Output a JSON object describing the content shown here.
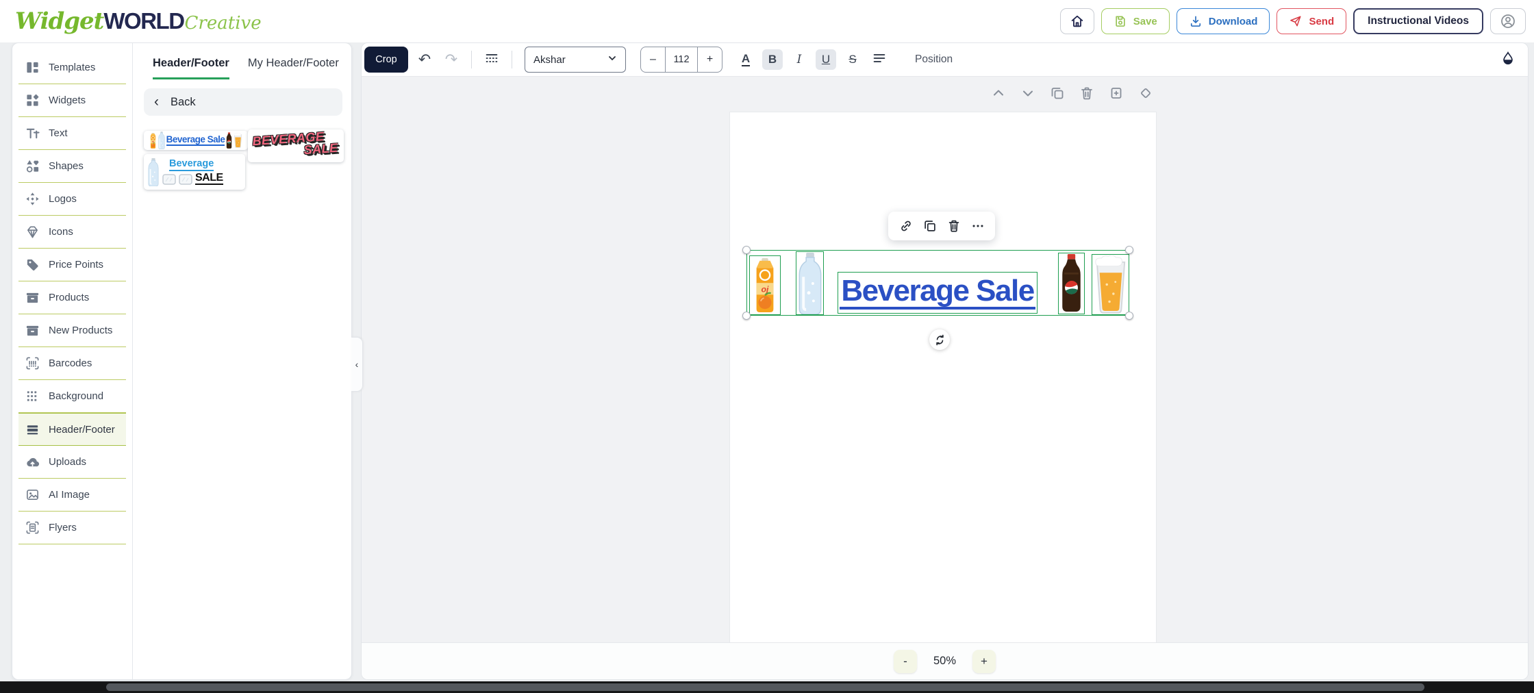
{
  "app": {
    "logo": {
      "widget": "Widget",
      "world": "WORLD",
      "creative": "Creative"
    }
  },
  "header": {
    "save": "Save",
    "download": "Download",
    "send": "Send",
    "instructional_videos": "Instructional Videos"
  },
  "sidebar": {
    "items": [
      {
        "label": "Templates",
        "icon": "templates-icon",
        "active": false
      },
      {
        "label": "Widgets",
        "icon": "widgets-icon",
        "active": false
      },
      {
        "label": "Text",
        "icon": "text-icon",
        "active": false
      },
      {
        "label": "Shapes",
        "icon": "shapes-icon",
        "active": false
      },
      {
        "label": "Logos",
        "icon": "logos-icon",
        "active": false
      },
      {
        "label": "Icons",
        "icon": "icons-icon",
        "active": false
      },
      {
        "label": "Price Points",
        "icon": "price-points-icon",
        "active": false
      },
      {
        "label": "Products",
        "icon": "products-icon",
        "active": false
      },
      {
        "label": "New Products",
        "icon": "new-products-icon",
        "active": false
      },
      {
        "label": "Barcodes",
        "icon": "barcodes-icon",
        "active": false
      },
      {
        "label": "Background",
        "icon": "background-icon",
        "active": false
      },
      {
        "label": "Header/Footer",
        "icon": "header-footer-icon",
        "active": true
      },
      {
        "label": "Uploads",
        "icon": "uploads-icon",
        "active": false
      },
      {
        "label": "AI Image",
        "icon": "ai-image-icon",
        "active": false
      },
      {
        "label": "Flyers",
        "icon": "flyers-icon",
        "active": false
      }
    ]
  },
  "panel": {
    "tabs": {
      "header_footer": "Header/Footer",
      "my_header_footer": "My Header/Footer"
    },
    "back": "Back",
    "thumbnails": [
      {
        "name": "beverage-sale-horizontal-banner",
        "text": "Beverage Sale"
      },
      {
        "name": "beverage-sale-3d-pink",
        "line1": "BEVERAGE",
        "line2": "SALE"
      },
      {
        "name": "beverage-sale-ice",
        "line1": "Beverage",
        "line2": "SALE"
      }
    ]
  },
  "toolbar": {
    "crop": "Crop",
    "font": "Akshar",
    "size_minus": "–",
    "size": "112",
    "size_plus": "+",
    "color_glyph": "A",
    "bold_glyph": "B",
    "italic_glyph": "I",
    "underline_glyph": "U",
    "strike_glyph": "S",
    "position": "Position"
  },
  "icons": {
    "undo": "↶",
    "redo": "↷",
    "back_chevron": "‹",
    "collapse_chevron": "‹"
  },
  "canvas": {
    "banner_text": "Beverage Sale",
    "zoom_minus": "-",
    "zoom_level": "50%",
    "zoom_plus": "+"
  },
  "colors": {
    "brand_green": "#76b82d",
    "brand_navy": "#232850",
    "save_green": "#97c355",
    "download_blue": "#2b6fc0",
    "send_red": "#d83a43",
    "crop_navy": "#111b36",
    "selection_green": "#1e9e50",
    "banner_text_blue": "#2b50c4",
    "tab_underline_green": "#27a05a",
    "sidebar_separator_green": "#bccb63",
    "active_item_bg": "#f4f7e9"
  }
}
